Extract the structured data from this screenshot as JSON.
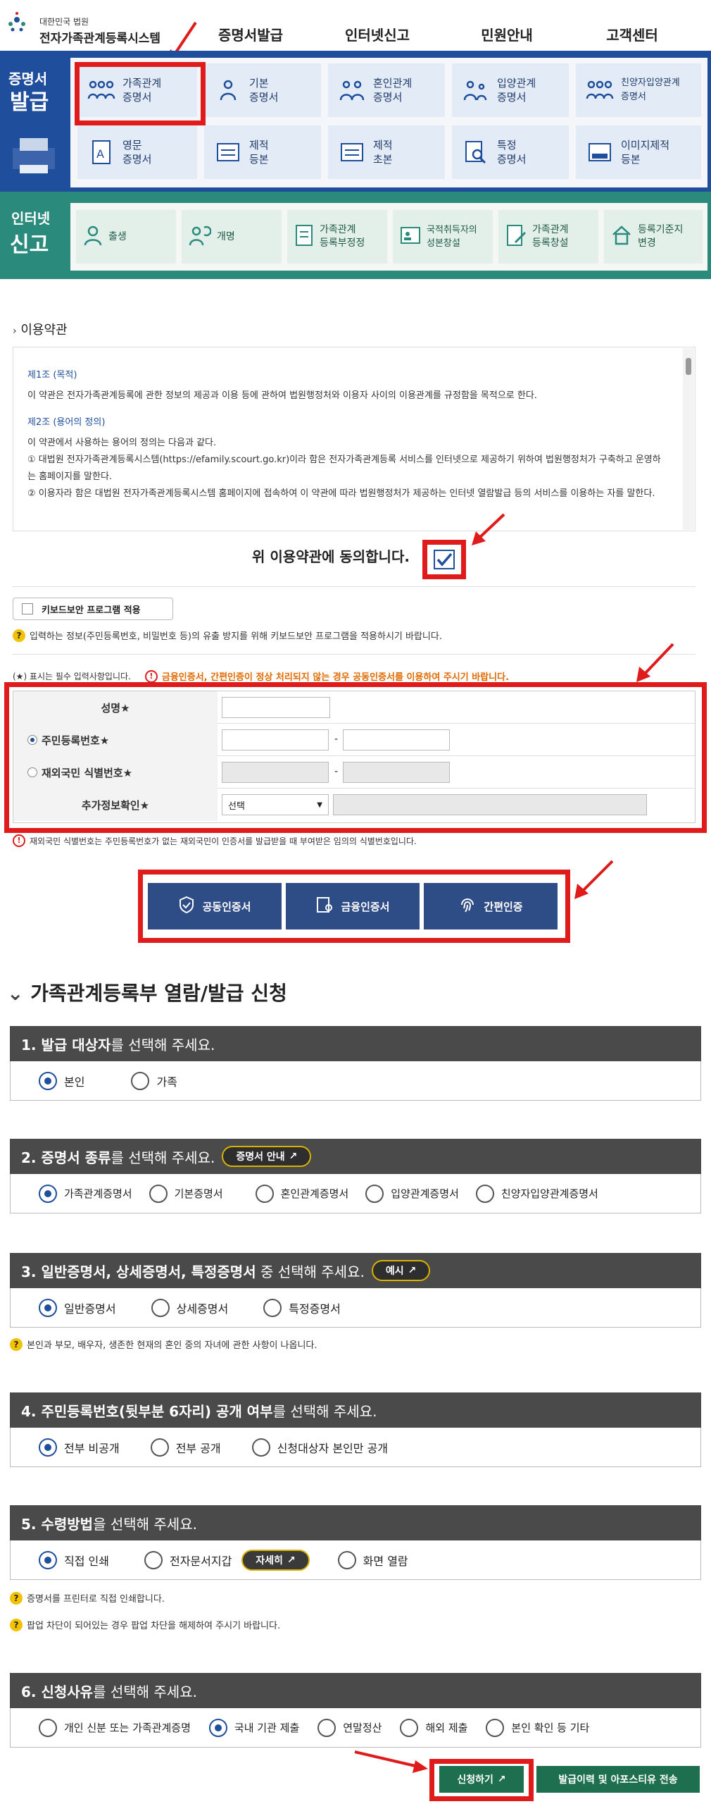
{
  "header": {
    "logo_line1": "대한민국 법원",
    "logo_line2": "전자가족관계등록시스템",
    "nav": [
      "증명서발급",
      "인터넷신고",
      "민원안내",
      "고객센터"
    ]
  },
  "issue": {
    "side_title_1": "증명서",
    "side_title_2": "발급",
    "cards": [
      {
        "label": "가족관계\n증명서",
        "icon": "family-icon"
      },
      {
        "label": "기본\n증명서",
        "icon": "person-icon"
      },
      {
        "label": "혼인관계\n증명서",
        "icon": "couple-icon"
      },
      {
        "label": "입양관계\n증명서",
        "icon": "adoption-icon"
      },
      {
        "label": "친양자입양관계\n증명서",
        "icon": "family-icon"
      },
      {
        "label": "영문\n증명서",
        "icon": "english-doc-icon"
      },
      {
        "label": "제적\n등본",
        "icon": "register-icon"
      },
      {
        "label": "제적\n초본",
        "icon": "register-icon"
      },
      {
        "label": "특정\n증명서",
        "icon": "search-doc-icon"
      },
      {
        "label": "이미지제적\n등본",
        "icon": "image-doc-icon"
      }
    ]
  },
  "report": {
    "side_title_1": "인터넷",
    "side_title_2": "신고",
    "cards": [
      {
        "label": "출생",
        "icon": "baby-icon"
      },
      {
        "label": "개명",
        "icon": "rename-icon"
      },
      {
        "label": "가족관계\n등록부정정",
        "icon": "form-icon"
      },
      {
        "label": "국적취득자의\n성본창설",
        "icon": "id-card-icon"
      },
      {
        "label": "가족관계\n등록창설",
        "icon": "edit-doc-icon"
      },
      {
        "label": "등록기준지\n변경",
        "icon": "house-icon"
      }
    ]
  },
  "terms": {
    "section_title": "이용약관",
    "article1_title": "제1조 (목적)",
    "article1_body": "이 약관은 전자가족관계등록에 관한 정보의 제공과 이용 등에 관하여 법원행정처와 이용자 사이의 이용관계를 규정함을 목적으로 한다.",
    "article2_title": "제2조 (용어의 정의)",
    "article2_intro": "이 약관에서 사용하는 용어의 정의는 다음과 같다.",
    "article2_item1": "① 대법원 전자가족관계등록시스템(https://efamily.scourt.go.kr)이라 함은 전자가족관계등록 서비스를 인터넷으로 제공하기 위하여 법원행정처가 구축하고 운영하는 홈페이지를 말한다.",
    "article2_item2": "② 이용자라 함은 대법원 전자가족관계등록시스템 홈페이지에 접속하여 이 약관에 따라 법원행정처가 제공하는 인터넷 열람발급 등의 서비스를 이용하는 자를 말한다.",
    "agree_label": "위 이용약관에 동의합니다.",
    "agree_checked": true
  },
  "security": {
    "keyboard_label": "키보드보안 프로그램 적용",
    "keyboard_note": "입력하는 정보(주민등록번호, 비밀번호 등)의 유출 방지를 위해 키보드보안 프로그램을 적용하시기 바랍니다.",
    "required_note": "(★) 표시는 필수 입력사항입니다.",
    "warn_note": "금융인증서, 간편인증이 정상 처리되지 않는 경우 공동인증서를 이용하여 주시기 바랍니다."
  },
  "form": {
    "name_label": "성명★",
    "rrn_label": "주민등록번호★",
    "foreign_label": "재외국민 식별번호★",
    "extra_label": "추가정보확인★",
    "dash": "-",
    "select_value": "선택",
    "foreign_note": "재외국민 식별번호는 주민등록번호가 없는 재외국민이 인증서를 발급받을 때 부여받은 임의의 식별번호입니다."
  },
  "cert_buttons": [
    "공동인증서",
    "금융인증서",
    "간편인증"
  ],
  "application": {
    "title": "가족관계등록부 열람/발급 신청",
    "steps": [
      {
        "bold": "1. 발급 대상자",
        "plain": "를 선택해 주세요.",
        "options": [
          "본인",
          "가족"
        ],
        "selected": 0
      },
      {
        "bold": "2. 증명서 종류",
        "plain": "를 선택해 주세요.",
        "pill": "증명서 안내",
        "options": [
          "가족관계증명서",
          "기본증명서",
          "혼인관계증명서",
          "입양관계증명서",
          "친양자입양관계증명서"
        ],
        "selected": 0
      },
      {
        "bold": "3. 일반증명서, 상세증명서, 특정증명서",
        "plain": " 중 선택해 주세요.",
        "pill": "예시",
        "options": [
          "일반증명서",
          "상세증명서",
          "특정증명서"
        ],
        "selected": 0,
        "note": "본인과 부모, 배우자, 생존한 현재의 혼인 중의 자녀에 관한 사항이 나옵니다."
      },
      {
        "bold": "4. 주민등록번호(뒷부분 6자리) 공개 여부",
        "plain": "를 선택해 주세요.",
        "options": [
          "전부 비공개",
          "전부 공개",
          "신청대상자 본인만 공개"
        ],
        "selected": 0
      },
      {
        "bold": "5. 수령방법",
        "plain": "을 선택해 주세요.",
        "options": [
          "직접 인쇄",
          "전자문서지갑",
          "화면 열람"
        ],
        "selected": 0,
        "inline_pill": "자세히",
        "note1": "증명서를 프린터로 직접 인쇄합니다.",
        "note2": "팝업 차단이 되어있는 경우 팝업 차단을 해제하여 주시기 바랍니다."
      },
      {
        "bold": "6. 신청사유",
        "plain": "를 선택해 주세요.",
        "options": [
          "개인 신분 또는 가족관계증명",
          "국내 기관 제출",
          "연말정산",
          "해외 제출",
          "본인 확인 등 기타"
        ],
        "selected": 1
      }
    ],
    "submit_label": "신청하기",
    "history_label": "발급이력 및 아포스티유 전송"
  }
}
